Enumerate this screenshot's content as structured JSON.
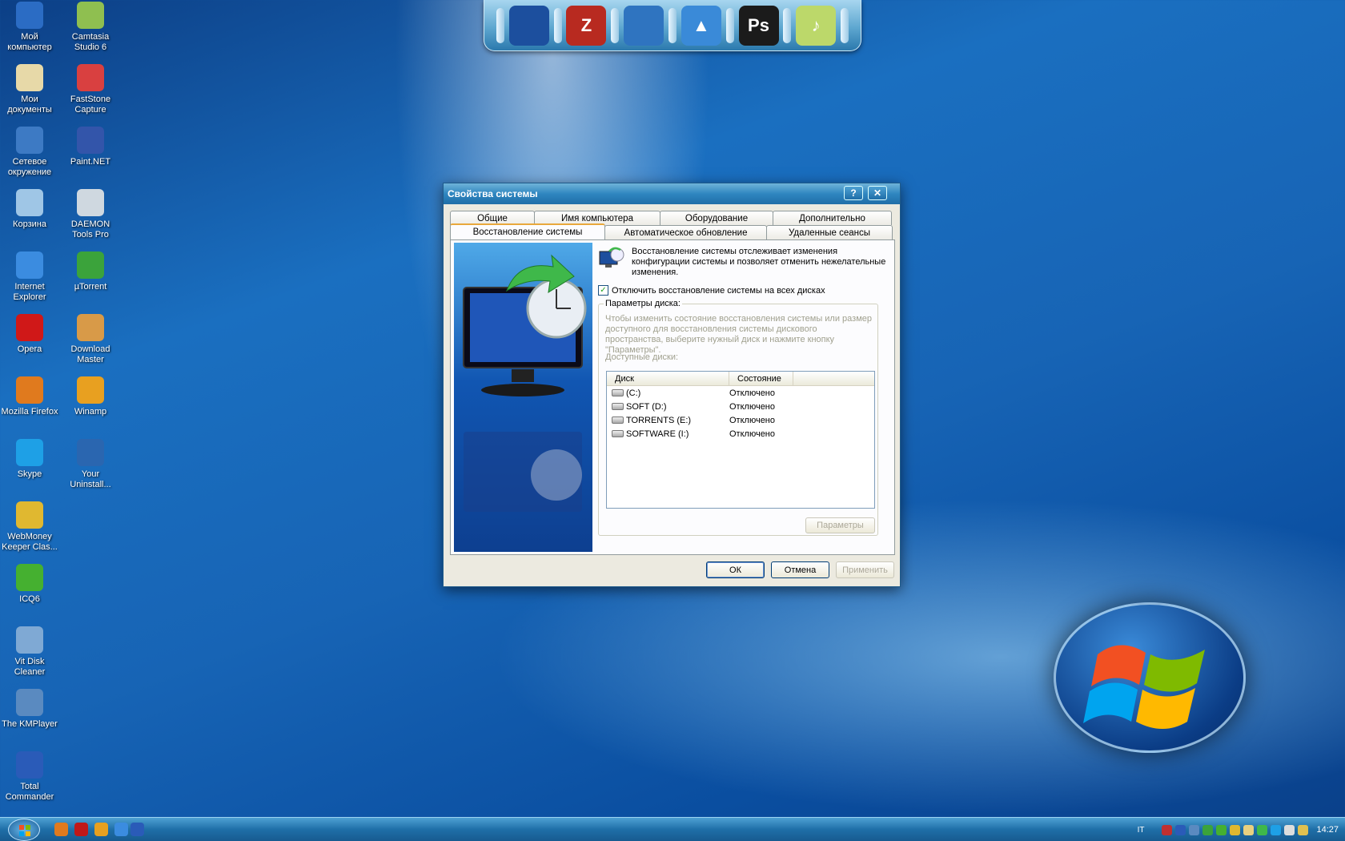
{
  "desktop": {
    "icons": [
      {
        "label": "Мой компьютер",
        "icon": "my-computer-icon",
        "color": "#2b6cc4"
      },
      {
        "label": "Camtasia Studio 6",
        "icon": "camtasia-icon",
        "color": "#8fbf50"
      },
      {
        "label": "Мои документы",
        "icon": "my-documents-icon",
        "color": "#e7d9a8"
      },
      {
        "label": "FastStone Capture",
        "icon": "faststone-icon",
        "color": "#d94040"
      },
      {
        "label": "Сетевое окружение",
        "icon": "network-icon",
        "color": "#3d7ac4"
      },
      {
        "label": "Paint.NET",
        "icon": "paintnet-icon",
        "color": "#3355aa"
      },
      {
        "label": "Корзина",
        "icon": "recycle-bin-icon",
        "color": "#9fc6e6"
      },
      {
        "label": "DAEMON Tools Pro",
        "icon": "daemon-tools-icon",
        "color": "#cfd8e0"
      },
      {
        "label": "Internet Explorer",
        "icon": "internet-explorer-icon",
        "color": "#3b8ce0"
      },
      {
        "label": "µTorrent",
        "icon": "utorrent-icon",
        "color": "#3ba33b"
      },
      {
        "label": "Opera",
        "icon": "opera-icon",
        "color": "#d01818"
      },
      {
        "label": "Download Master",
        "icon": "download-master-icon",
        "color": "#d89a48"
      },
      {
        "label": "Mozilla Firefox",
        "icon": "firefox-icon",
        "color": "#e07a1e"
      },
      {
        "label": "Winamp",
        "icon": "winamp-icon",
        "color": "#e8a020"
      },
      {
        "label": "Skype",
        "icon": "skype-icon",
        "color": "#1ea0e6"
      },
      {
        "label": "Your Uninstall...",
        "icon": "your-uninstaller-icon",
        "color": "#2a66b0"
      },
      {
        "label": "WebMoney Keeper Clas...",
        "icon": "webmoney-icon",
        "color": "#e0b830"
      },
      {
        "label": "ICQ6",
        "icon": "icq-icon",
        "color": "#45b030"
      },
      {
        "label": "Vit Disk Cleaner",
        "icon": "disk-cleaner-icon",
        "color": "#7fa9d4"
      },
      {
        "label": "The KMPlayer",
        "icon": "kmplayer-icon",
        "color": "#5a8ac0"
      },
      {
        "label": "Total Commander",
        "icon": "total-commander-icon",
        "color": "#2a5bb8"
      }
    ]
  },
  "dock": {
    "items": [
      {
        "name": "computer-dock-icon",
        "glyph": "",
        "color": "#1c4f9e"
      },
      {
        "name": "filezilla-dock-icon",
        "glyph": "Z",
        "color": "#b82a20"
      },
      {
        "name": "network-globe-dock-icon",
        "glyph": "",
        "color": "#2f74c0"
      },
      {
        "name": "upload-arrow-dock-icon",
        "glyph": "▲",
        "color": "#3a8ad8"
      },
      {
        "name": "photoshop-dock-icon",
        "glyph": "Ps",
        "color": "#1b1b1b"
      },
      {
        "name": "audio-editor-dock-icon",
        "glyph": "♪",
        "color": "#bcd86a"
      }
    ]
  },
  "dialog": {
    "title": "Свойства системы",
    "help_glyph": "?",
    "close_glyph": "✕",
    "tabs_back": [
      "Общие",
      "Имя компьютера",
      "Оборудование",
      "Дополнительно"
    ],
    "tabs_front": [
      "Восстановление системы",
      "Автоматическое обновление",
      "Удаленные сеансы"
    ],
    "info_text": "Восстановление системы отслеживает изменения конфигурации системы и позволяет отменить нежелательные изменения.",
    "checkbox_label": "Отключить восстановление системы на всех дисках",
    "checkbox_checked": true,
    "checkbox_mark": "✓",
    "group_title": "Параметры диска:",
    "group_hint": "Чтобы изменить состояние восстановления системы или размер доступного для восстановления системы дискового пространства, выберите нужный диск и нажмите кнопку \"Параметры\".",
    "available_label": "Доступные диски:",
    "columns": [
      "Диск",
      "Состояние"
    ],
    "drives": [
      {
        "name": "(C:)",
        "status": "Отключено"
      },
      {
        "name": "SOFT (D:)",
        "status": "Отключено"
      },
      {
        "name": "TORRENTS (E:)",
        "status": "Отключено"
      },
      {
        "name": "SOFTWARE (I:)",
        "status": "Отключено"
      }
    ],
    "params_button": "Параметры",
    "ok_button": "ОК",
    "cancel_button": "Отмена",
    "apply_button": "Применить"
  },
  "taskbar": {
    "language": "IT",
    "clock": "14:27"
  }
}
